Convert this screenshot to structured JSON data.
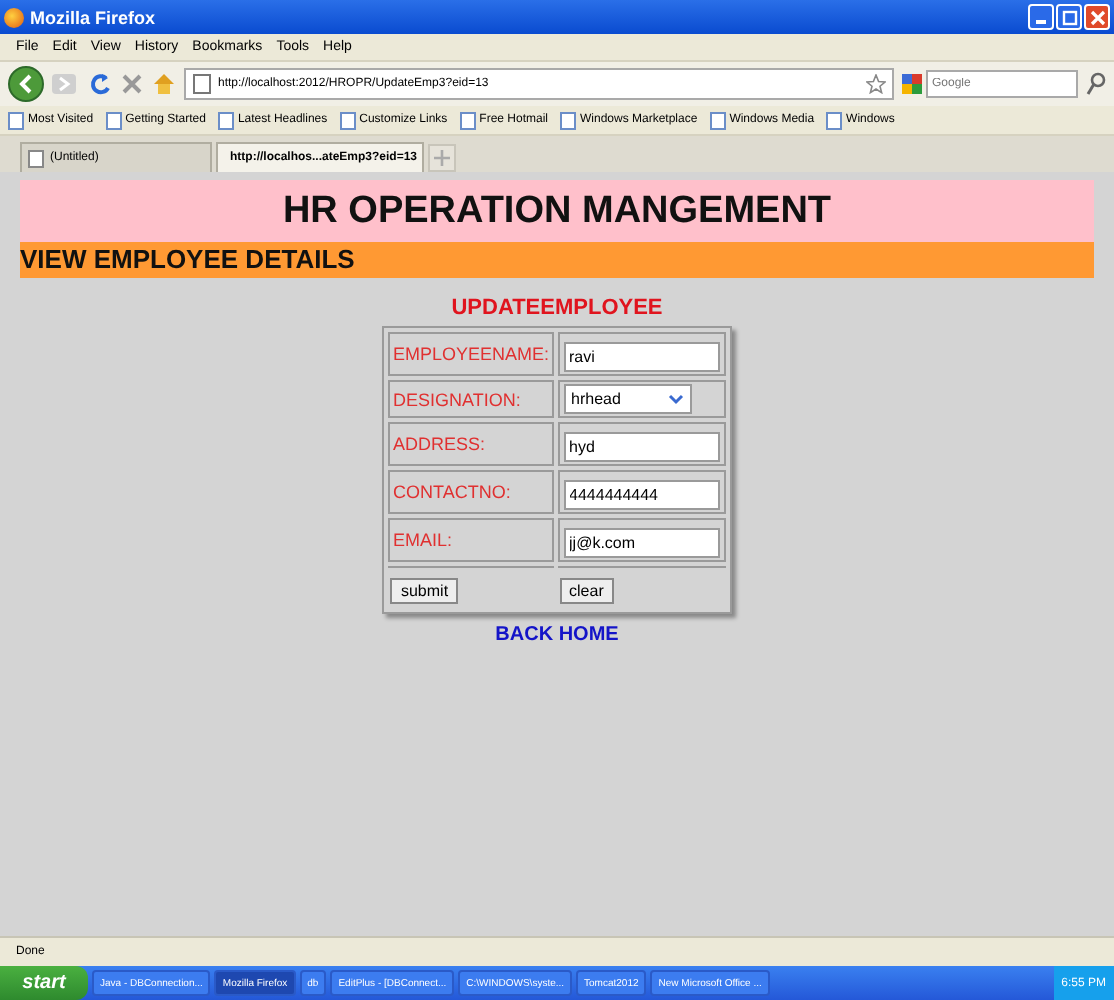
{
  "window": {
    "title": "Mozilla Firefox"
  },
  "menu": [
    "File",
    "Edit",
    "View",
    "History",
    "Bookmarks",
    "Tools",
    "Help"
  ],
  "address": {
    "value": "http://localhost:2012/HROPR/UpdateEmp3?eid=13"
  },
  "search": {
    "placeholder": "Google"
  },
  "bookmarks": [
    "Most Visited",
    "Getting Started",
    "Latest Headlines",
    "Customize Links",
    "Free Hotmail",
    "Windows Marketplace",
    "Windows Media",
    "Windows"
  ],
  "tabs": [
    {
      "label": "(Untitled)",
      "selected": false
    },
    {
      "label": "http://localhos...ateEmp3?eid=13",
      "selected": true
    }
  ],
  "page": {
    "header": "HR OPERATION MANGEMENT",
    "subheader": "VIEW EMPLOYEE DETAILS",
    "form_title": "UPDATEEMPLOYEE",
    "fields": [
      {
        "label": "EMPLOYEENAME:",
        "kind": "text",
        "value": "ravi"
      },
      {
        "label": "DESIGNATION:",
        "kind": "select",
        "value": "hrhead"
      },
      {
        "label": "ADDRESS:",
        "kind": "text",
        "value": "hyd"
      },
      {
        "label": "CONTACTNO:",
        "kind": "text",
        "value": "4444444444"
      },
      {
        "label": "EMAIL:",
        "kind": "text",
        "value": "jj@k.com"
      }
    ],
    "buttons": [
      "submit",
      "clear"
    ],
    "link": "BACK HOME"
  },
  "status_bar": "Done",
  "taskbar": {
    "start": "start",
    "items": [
      {
        "label": "Java - DBConnection...",
        "selected": false
      },
      {
        "label": "Mozilla Firefox",
        "selected": true
      },
      {
        "label": "db",
        "selected": false
      },
      {
        "label": "EditPlus - [DBConnect...",
        "selected": false
      },
      {
        "label": "C:\\WINDOWS\\syste...",
        "selected": false
      },
      {
        "label": "Tomcat2012",
        "selected": false
      },
      {
        "label": "New Microsoft Office ...",
        "selected": false
      }
    ],
    "clock": "6:55 PM"
  }
}
